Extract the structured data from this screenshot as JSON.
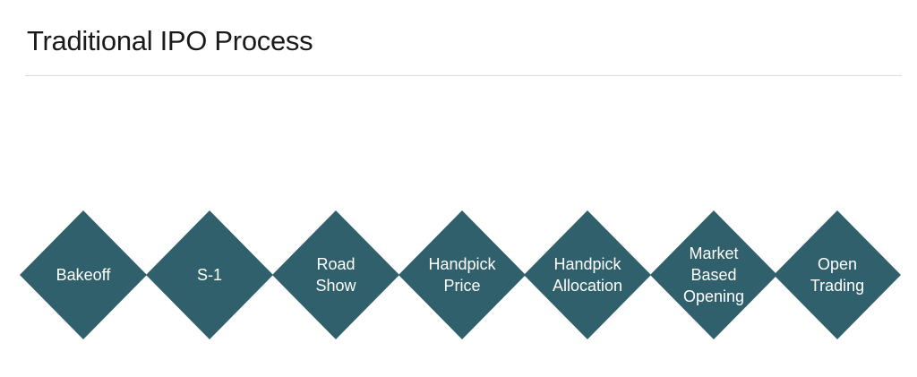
{
  "title": "Traditional IPO Process",
  "colors": {
    "diamond_fill": "#30606b",
    "label_text": "#ffffff",
    "title_text": "#1a1a1a",
    "divider": "#dcdcdc"
  },
  "steps": [
    {
      "label": "Bakeoff"
    },
    {
      "label": "S-1"
    },
    {
      "label": "Road\nShow"
    },
    {
      "label": "Handpick\nPrice"
    },
    {
      "label": "Handpick\nAllocation"
    },
    {
      "label": "Market\nBased\nOpening"
    },
    {
      "label": "Open\nTrading"
    }
  ]
}
